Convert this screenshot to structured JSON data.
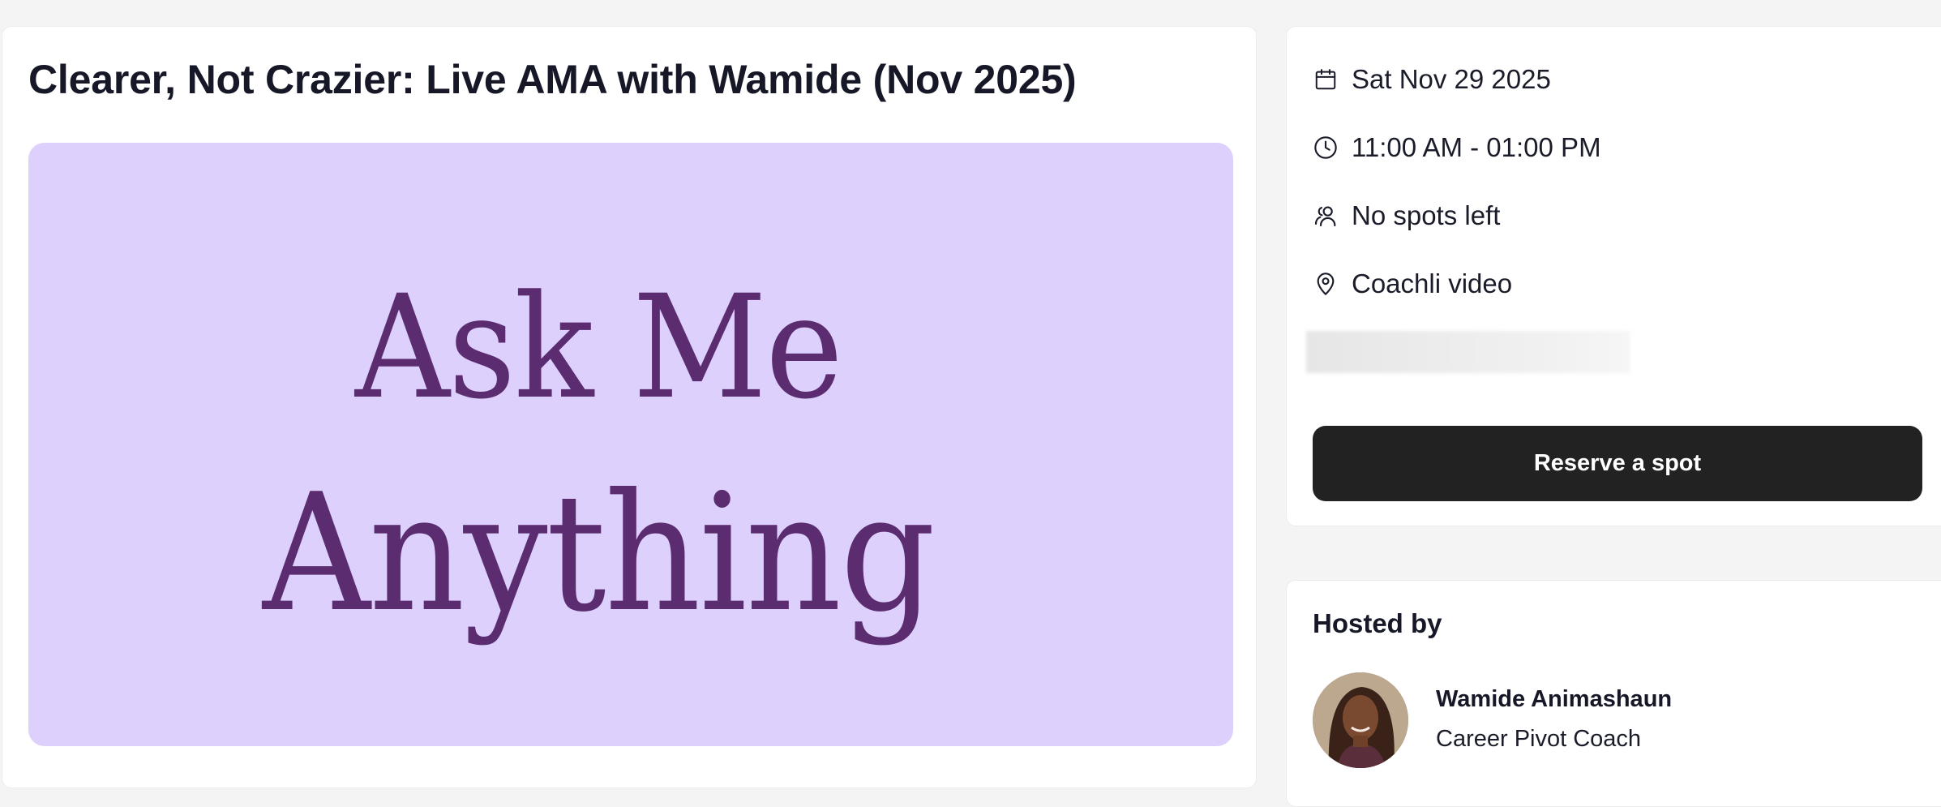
{
  "event": {
    "title": "Clearer, Not Crazier: Live AMA with Wamide (Nov 2025)",
    "banner": {
      "line1": "Ask Me",
      "line2": "Anything",
      "background_color": "#ddd0fd",
      "text_color": "#5b2c6f"
    }
  },
  "details": {
    "date": {
      "icon": "calendar-icon",
      "text": "Sat Nov 29 2025"
    },
    "time": {
      "icon": "clock-icon",
      "text": "11:00 AM - 01:00 PM"
    },
    "spots": {
      "icon": "people-icon",
      "text": "No spots left"
    },
    "location": {
      "icon": "map-pin-icon",
      "text": "Coachli video"
    }
  },
  "actions": {
    "reserve_label": "Reserve a spot",
    "reserve_color": "#222222"
  },
  "host": {
    "heading": "Hosted by",
    "name": "Wamide Animashaun",
    "role": "Career Pivot Coach"
  }
}
